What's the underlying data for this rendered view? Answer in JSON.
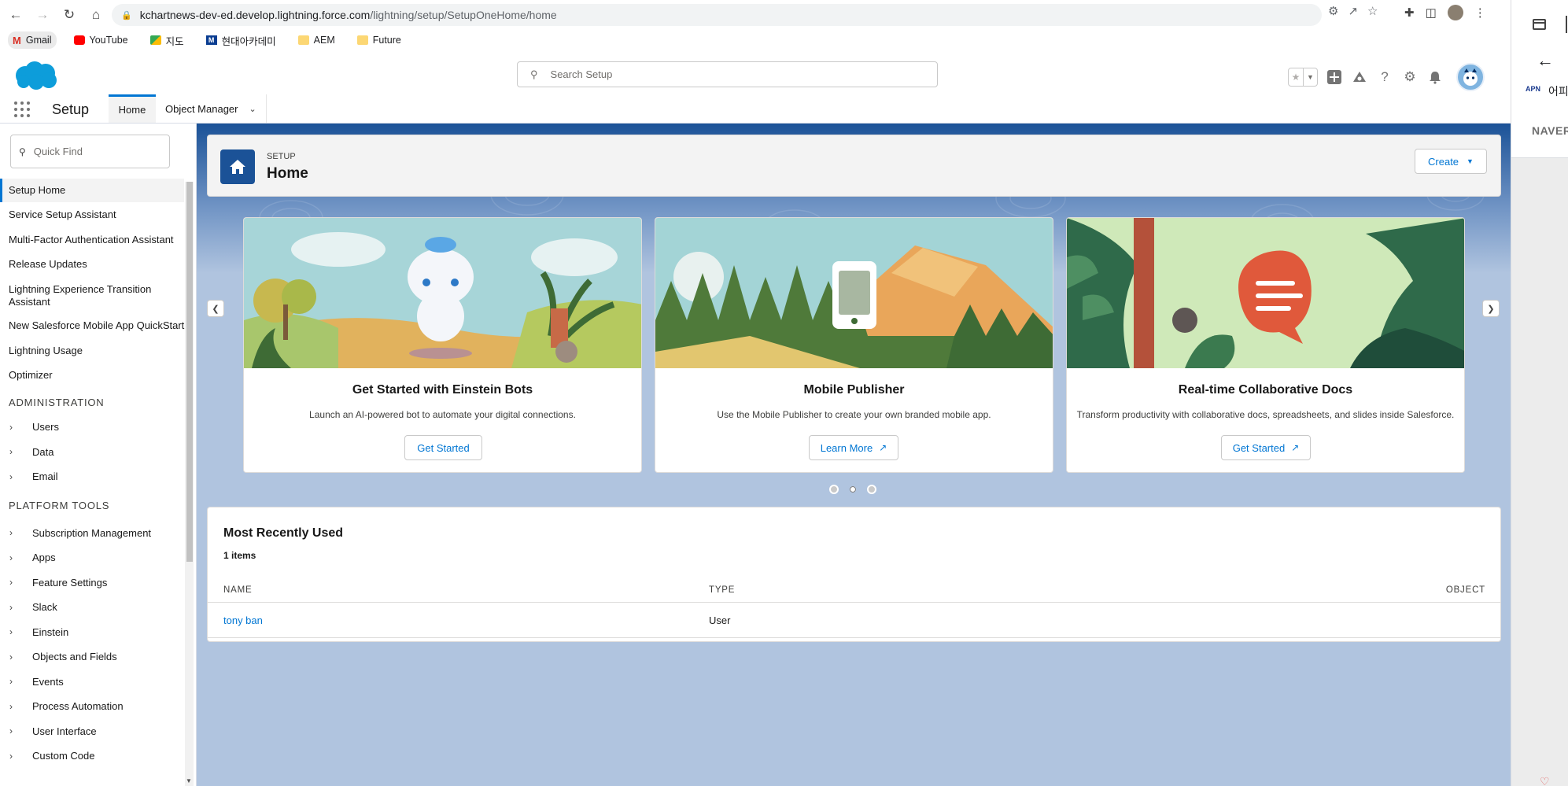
{
  "browser": {
    "url_domain": "kchartnews-dev-ed.develop.lightning.force.com",
    "url_path": "/lightning/setup/SetupOneHome/home",
    "bookmarks": [
      {
        "label": "Gmail",
        "icon": "gmail-icon"
      },
      {
        "label": "YouTube",
        "icon": "youtube-icon"
      },
      {
        "label": "지도",
        "icon": "maps-icon"
      },
      {
        "label": "현대아카데미",
        "icon": "m-icon"
      },
      {
        "label": "AEM",
        "icon": "folder-icon"
      },
      {
        "label": "Future",
        "icon": "folder-icon"
      }
    ]
  },
  "header": {
    "search_placeholder": "Search Setup"
  },
  "nav": {
    "app_name": "Setup",
    "tabs": [
      {
        "label": "Home",
        "active": true
      },
      {
        "label": "Object Manager",
        "active": false
      }
    ]
  },
  "sidebar": {
    "quickfind_placeholder": "Quick Find",
    "items": [
      {
        "label": "Setup Home",
        "active": true
      },
      {
        "label": "Service Setup Assistant"
      },
      {
        "label": "Multi-Factor Authentication Assistant"
      },
      {
        "label": "Release Updates"
      },
      {
        "label": "Lightning Experience Transition Assistant"
      },
      {
        "label": "New Salesforce Mobile App QuickStart"
      },
      {
        "label": "Lightning Usage"
      },
      {
        "label": "Optimizer"
      }
    ],
    "administration_title": "ADMINISTRATION",
    "administration_items": [
      "Users",
      "Data",
      "Email"
    ],
    "platform_title": "PLATFORM TOOLS",
    "platform_items": [
      "Subscription Management",
      "Apps",
      "Feature Settings",
      "Slack",
      "Einstein",
      "Objects and Fields",
      "Events",
      "Process Automation",
      "User Interface",
      "Custom Code"
    ]
  },
  "page_header": {
    "eyebrow": "SETUP",
    "title": "Home",
    "create_label": "Create"
  },
  "cards": [
    {
      "title": "Get Started with Einstein Bots",
      "description": "Launch an AI-powered bot to automate your digital connections.",
      "button": "Get Started"
    },
    {
      "title": "Mobile Publisher",
      "description": "Use the Mobile Publisher to create your own branded mobile app.",
      "button": "Learn More"
    },
    {
      "title": "Real-time Collaborative Docs",
      "description": "Transform productivity with collaborative docs, spreadsheets, and slides inside Salesforce.",
      "button": "Get Started"
    }
  ],
  "carousel": {
    "pages": 3,
    "current": 2
  },
  "mru": {
    "title": "Most Recently Used",
    "count": "1 items",
    "columns": [
      "NAME",
      "TYPE",
      "OBJECT"
    ],
    "rows": [
      {
        "name": "tony ban",
        "type": "User",
        "object": ""
      }
    ]
  },
  "side_panel": {
    "apn_label": "APN",
    "apn_text": "어피",
    "naver_label": "NAVER"
  },
  "colors": {
    "brand_blue": "#0176d3",
    "setup_blue": "#1b5297",
    "content_bg": "#b0c4df"
  }
}
